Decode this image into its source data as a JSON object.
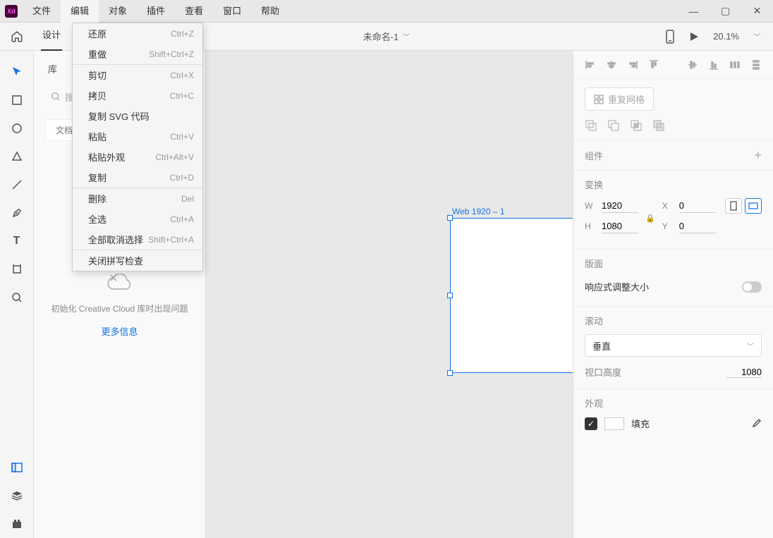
{
  "menubar": {
    "items": [
      "文件",
      "编辑",
      "对象",
      "插件",
      "查看",
      "窗口",
      "帮助"
    ],
    "open_index": 1
  },
  "edit_menu": [
    {
      "label": "还原",
      "shortcut": "Ctrl+Z"
    },
    {
      "label": "重做",
      "shortcut": "Shift+Ctrl+Z"
    },
    {
      "sep": true
    },
    {
      "label": "剪切",
      "shortcut": "Ctrl+X"
    },
    {
      "label": "拷贝",
      "shortcut": "Ctrl+C"
    },
    {
      "label": "复制 SVG 代码",
      "shortcut": ""
    },
    {
      "label": "粘贴",
      "shortcut": "Ctrl+V"
    },
    {
      "label": "粘贴外观",
      "shortcut": "Ctrl+Alt+V"
    },
    {
      "label": "复制",
      "shortcut": "Ctrl+D"
    },
    {
      "sep": true
    },
    {
      "label": "删除",
      "shortcut": "Del"
    },
    {
      "label": "全选",
      "shortcut": "Ctrl+A"
    },
    {
      "label": "全部取消选择",
      "shortcut": "Shift+Ctrl+A"
    },
    {
      "sep": true
    },
    {
      "label": "关闭拼写检查",
      "shortcut": ""
    }
  ],
  "tabs": {
    "design": "设计"
  },
  "document": {
    "title": "未命名-1"
  },
  "zoom": {
    "percent": "20.1%"
  },
  "left_panel": {
    "tab": "库",
    "search_placeholder": "搜",
    "chip": "文档资",
    "cloud_msg": "初始化 Creative Cloud 库时出现问题",
    "more_link": "更多信息"
  },
  "canvas": {
    "artboard_label": "Web 1920 – 1"
  },
  "right_panel": {
    "repeat_grid": "重复网格",
    "component": "组件",
    "transform": "变换",
    "dims": {
      "w_label": "W",
      "w": "1920",
      "h_label": "H",
      "h": "1080",
      "x_label": "X",
      "x": "0",
      "y_label": "Y",
      "y": "0"
    },
    "layout": "版面",
    "responsive": "响应式调整大小",
    "scroll": "滚动",
    "scroll_value": "垂直",
    "viewport_label": "视口高度",
    "viewport_value": "1080",
    "appearance": "外观",
    "fill": "填充"
  }
}
